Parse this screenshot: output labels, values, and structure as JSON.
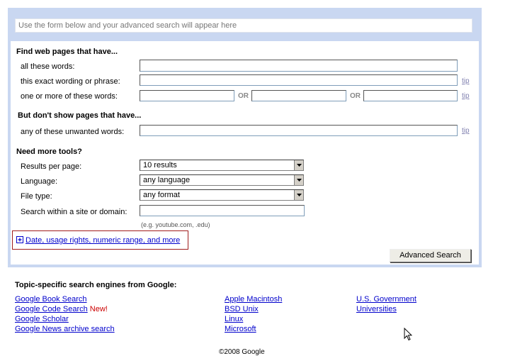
{
  "preview_text": "Use the form below and your advanced search will appear here",
  "find": {
    "heading": "Find web pages that have...",
    "all_words_label": "all these words:",
    "exact_label": "this exact wording or phrase:",
    "any_label": "one or more of these words:",
    "or_text": "OR",
    "tip": "tip"
  },
  "exclude": {
    "heading": "But don't show pages that have...",
    "unwanted_label": "any of these unwanted words:",
    "tip": "tip"
  },
  "tools": {
    "heading": "Need more tools?",
    "results_label": "Results per page:",
    "results_value": "10 results",
    "language_label": "Language:",
    "language_value": "any language",
    "filetype_label": "File type:",
    "filetype_value": "any format",
    "site_label": "Search within a site or domain:",
    "site_hint": "(e.g. youtube.com, .edu)"
  },
  "more_options": {
    "icon": "plus-box-icon",
    "label": "Date, usage rights, numeric range, and more"
  },
  "submit_label": "Advanced Search",
  "topic": {
    "heading": "Topic-specific search engines from Google:",
    "col1": [
      "Google Book Search",
      "Google Code Search",
      "Google Scholar",
      "Google News archive search"
    ],
    "new_badge": "New!",
    "col2": [
      "Apple Macintosh",
      "BSD Unix",
      "Linux",
      "Microsoft"
    ],
    "col3": [
      "U.S. Government",
      "Universities"
    ]
  },
  "footer": "©2008 Google",
  "colors": {
    "panel": "#c9d7f1",
    "link": "#0000cc",
    "new": "#cc0000",
    "more_border": "#a01c1c"
  }
}
